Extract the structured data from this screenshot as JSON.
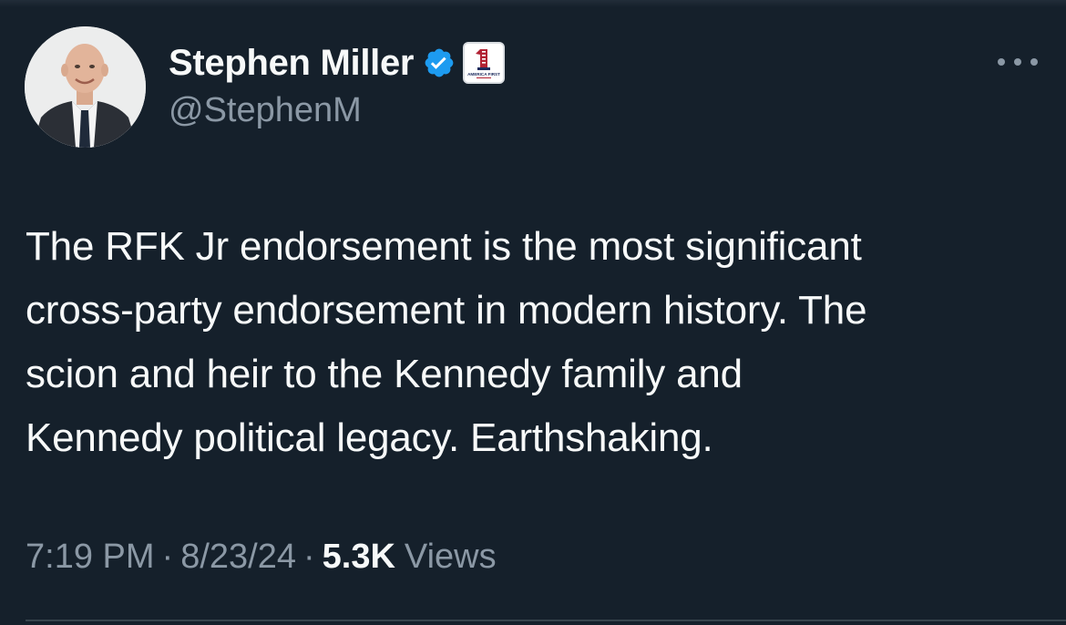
{
  "author": {
    "display_name": "Stephen Miller",
    "handle": "@StephenM",
    "verified": true,
    "verified_icon": "verified-badge-icon",
    "affiliate_badge": {
      "icon": "america-first-legal-logo",
      "text": "AMERICA FIRST"
    },
    "avatar_icon": "profile-photo"
  },
  "tweet": {
    "lines": [
      "The RFK Jr endorsement is the most significant",
      "cross-party endorsement in modern history. The",
      "scion and heir to the Kennedy family and",
      "Kennedy political legacy. Earthshaking."
    ]
  },
  "meta": {
    "time": "7:19 PM",
    "separator": "·",
    "date": "8/23/24",
    "views_count": "5.3K",
    "views_label": "Views"
  },
  "more_icon": "more-options-icon",
  "colors": {
    "background": "#15202b",
    "primary_text": "#f7f9f9",
    "secondary_text": "#8b98a5",
    "verified_blue": "#1d9bf0"
  }
}
